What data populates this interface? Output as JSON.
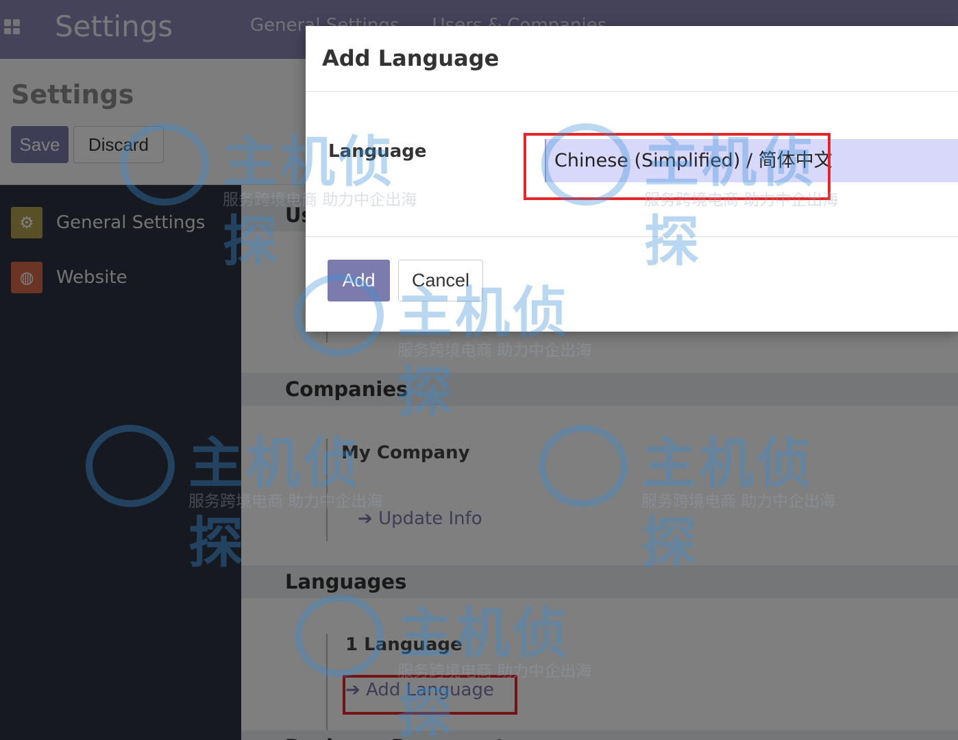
{
  "topbar": {
    "title": "Settings",
    "nav": [
      "General Settings",
      "Users & Companies"
    ]
  },
  "control": {
    "title": "Settings",
    "save_label": "Save",
    "discard_label": "Discard"
  },
  "sidebar": {
    "items": [
      {
        "label": "General Settings",
        "icon": "gear-icon",
        "color": "#b2a04f"
      },
      {
        "label": "Website",
        "icon": "globe-icon",
        "color": "#d9694b"
      }
    ]
  },
  "main": {
    "users_partial": "Us",
    "companies": {
      "heading": "Companies",
      "company_name": "My Company",
      "update_link": "Update Info"
    },
    "languages": {
      "heading": "Languages",
      "count": "1 Language",
      "add_link": "Add Language"
    },
    "footer_partial": "Business Documents"
  },
  "modal": {
    "title": "Add Language",
    "field_label": "Language",
    "selected_language": "Chinese (Simplified) / 简体中文",
    "add_label": "Add",
    "cancel_label": "Cancel"
  },
  "watermark": {
    "title": "主机侦探",
    "subtitle": "服务跨境电商 助力中企出海"
  },
  "colors": {
    "topbar": "#8a87b5",
    "primary": "#7c7bad",
    "sidebar": "#2e3241",
    "highlight": "#e4262b",
    "selection": "#d8d8fb"
  }
}
